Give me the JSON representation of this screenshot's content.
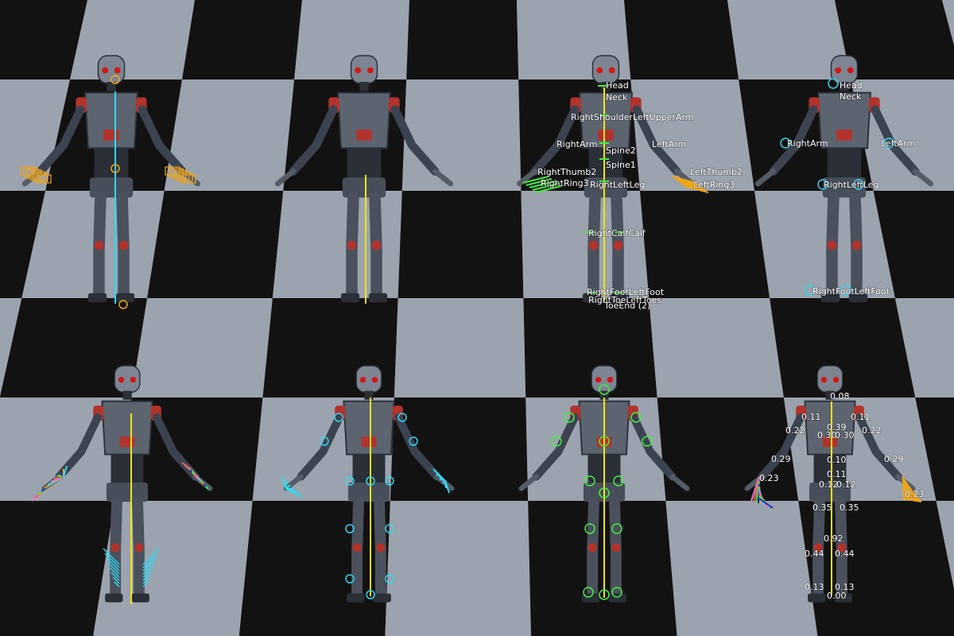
{
  "colors": {
    "floor_light": "#9ba3ae",
    "floor_dark": "#121212",
    "robot_body": "#5c6470",
    "robot_dark": "#2a2f38",
    "robot_eye": "#d01818",
    "robot_accent": "#b2332c",
    "bone_yellow": "#f2e21a",
    "bone_cyan": "#32d7f0",
    "bone_green": "#46ef3c",
    "hand_orange": "#f0a51a",
    "hand_pink": "#f07ad0"
  },
  "panels": {
    "top_center_right": {
      "labels": {
        "head": "Head",
        "neck": "Neck",
        "shoulders": "RightShoulderLeftUpperArm",
        "right_arm": "RightArm",
        "left_arm": "LeftArm",
        "spine2": "Spine2",
        "spine1": "Spine1",
        "right_thumb": "RightThumb2",
        "left_thumb": "LeftThumb2",
        "right_finger": "RightRing3",
        "left_finger": "LeftRing3",
        "legs": "RightLeftLeg",
        "calves": "RightCalfCalf",
        "feet": "RightFootLeftFoot",
        "toes": "RightToeLeftToes",
        "toe_end": "ToeEnd (2)"
      }
    },
    "top_right": {
      "labels": {
        "head": "Head",
        "neck": "Neck",
        "right_arm": "RightArm",
        "left_arm": "LeftArm",
        "legs": "RightLeftLeg",
        "feet": "RightFootLeftFoot"
      }
    },
    "bottom_right": {
      "values": {
        "head": "0.08",
        "shoulder_l": "0.11",
        "shoulder_r": "0.11",
        "upper_arm_l": "0.22",
        "upper_arm_r": "0.22",
        "chest": "0.39",
        "chest_l": "0.30",
        "chest_r": "0.30",
        "forearm_l": "0.29",
        "forearm_r": "0.29",
        "spine": "0.10",
        "hips": "0.11",
        "hip_l": "0.12",
        "hip_r": "0.12",
        "hand_l": "0.23",
        "hand_r": "0.23",
        "thigh_l": "0.35",
        "thigh_r": "0.35",
        "knee": "0.92",
        "calf_l": "0.44",
        "calf_r": "0.44",
        "foot_l": "0.13",
        "foot_r": "0.13",
        "toe": "0.00"
      }
    }
  }
}
